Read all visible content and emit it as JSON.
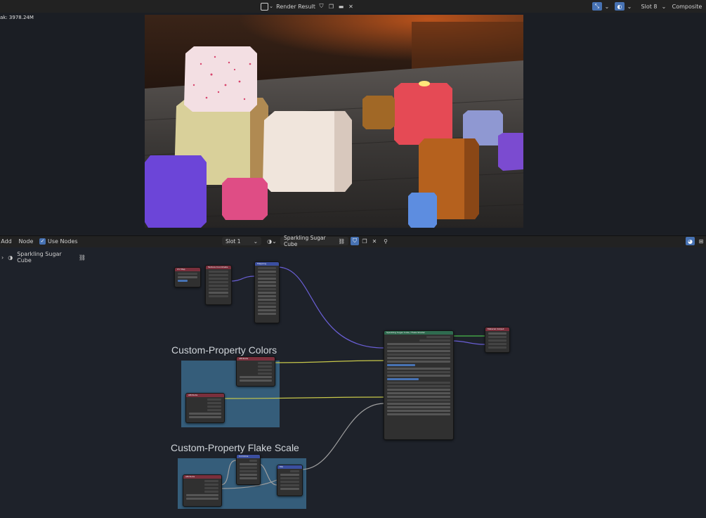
{
  "top_header": {
    "image_name": "Render Result",
    "slot": "Slot 8",
    "composite": "Composite",
    "memory": "ak: 3978.24M"
  },
  "node_header": {
    "menu_add": "Add",
    "menu_node": "Node",
    "use_nodes_label": "Use Nodes",
    "slot": "Slot 1",
    "material_name": "Sparkling Sugar Cube",
    "breadcrumb_material": "Sparkling Sugar Cube"
  },
  "frames": {
    "colors_label": "Custom-Property Colors",
    "flake_label": "Custom-Property Flake Scale"
  },
  "nodes": {
    "uv_map": "UV Map",
    "tex_coord": "Texture Coordinate",
    "mapping": "Mapping",
    "group": "Sparkling Sugar Cube / Flake Shader",
    "material_output": "Material Output",
    "attribute_1": "Attribute",
    "attribute_2": "Attribute",
    "attribute_3": "Attribute",
    "combine": "Combine",
    "mix": "Mix"
  },
  "colors": {
    "accent": "#4772b3",
    "frame": "#3a6788",
    "wire_vector": "#6a5fd6",
    "wire_color": "#c8c84a",
    "wire_float": "#a0a0a0",
    "wire_shader": "#4aba4a"
  },
  "icons": [
    "image-icon",
    "shield-icon",
    "copy-icon",
    "folder-icon",
    "close-icon",
    "overlay-icon",
    "viewer-icon",
    "material-sphere-icon",
    "pin-icon",
    "chevron-right-icon"
  ]
}
